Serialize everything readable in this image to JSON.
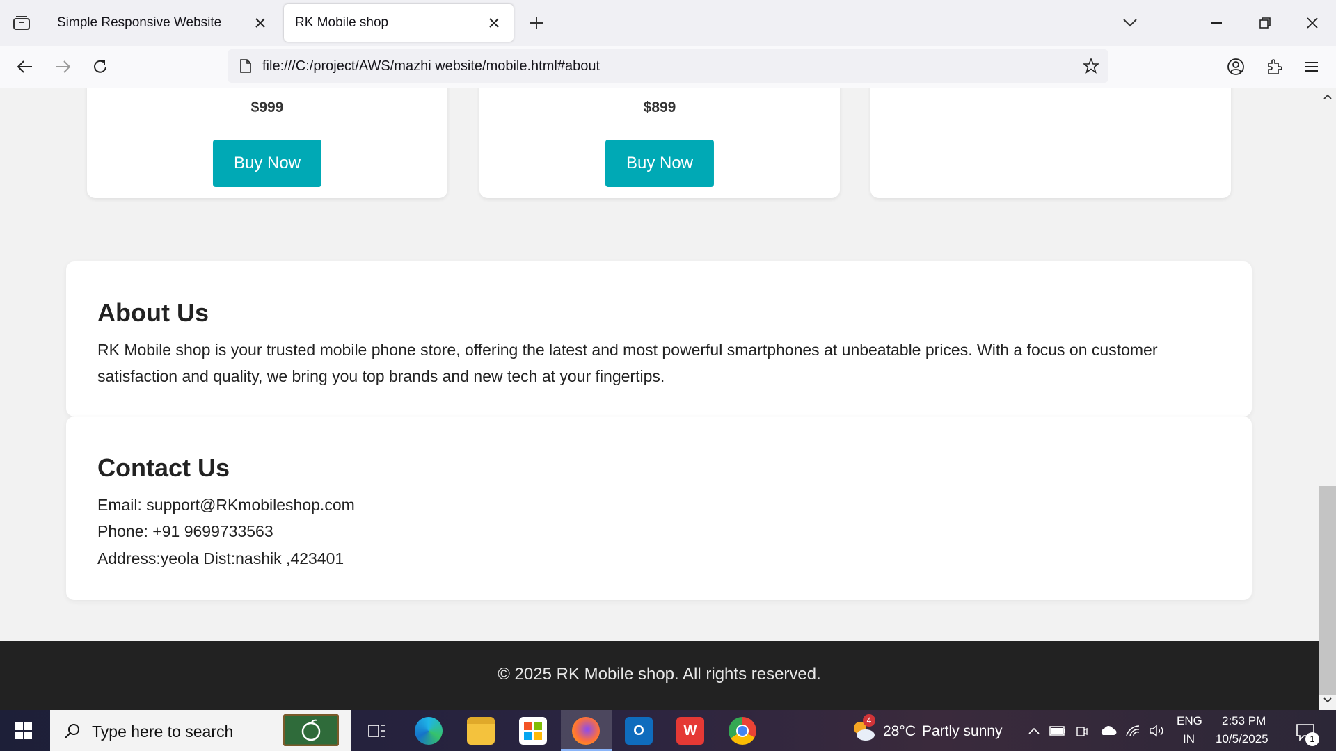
{
  "browser": {
    "tabs": [
      {
        "title": "Simple Responsive Website",
        "active": false
      },
      {
        "title": "RK Mobile shop",
        "active": true
      }
    ],
    "url": "file:///C:/project/AWS/mazhi website/mobile.html#about"
  },
  "products": [
    {
      "price": "$999",
      "button": "Buy Now"
    },
    {
      "price": "$899",
      "button": "Buy Now"
    },
    {
      "price": "",
      "button": ""
    }
  ],
  "about": {
    "heading": "About Us",
    "text": "RK Mobile shop is your trusted mobile phone store, offering the latest and most powerful smartphones at unbeatable prices. With a focus on customer satisfaction and quality, we bring you top brands and new tech at your fingertips."
  },
  "contact": {
    "heading": "Contact Us",
    "email": "Email: support@RKmobileshop.com",
    "phone": "Phone: +91 9699733563",
    "address": "Address:yeola Dist:nashik ,423401"
  },
  "footer": {
    "text": "© 2025 RK Mobile shop. All rights reserved."
  },
  "taskbar": {
    "search_placeholder": "Type here to search",
    "weather": {
      "badge": "4",
      "temp": "28°C",
      "condition": "Partly sunny"
    },
    "language": {
      "lang": "ENG",
      "region": "IN"
    },
    "clock": {
      "time": "2:53 PM",
      "date": "10/5/2025"
    },
    "notifications": "1"
  },
  "colors": {
    "accent": "#00a9b5",
    "footer_bg": "#222222"
  }
}
